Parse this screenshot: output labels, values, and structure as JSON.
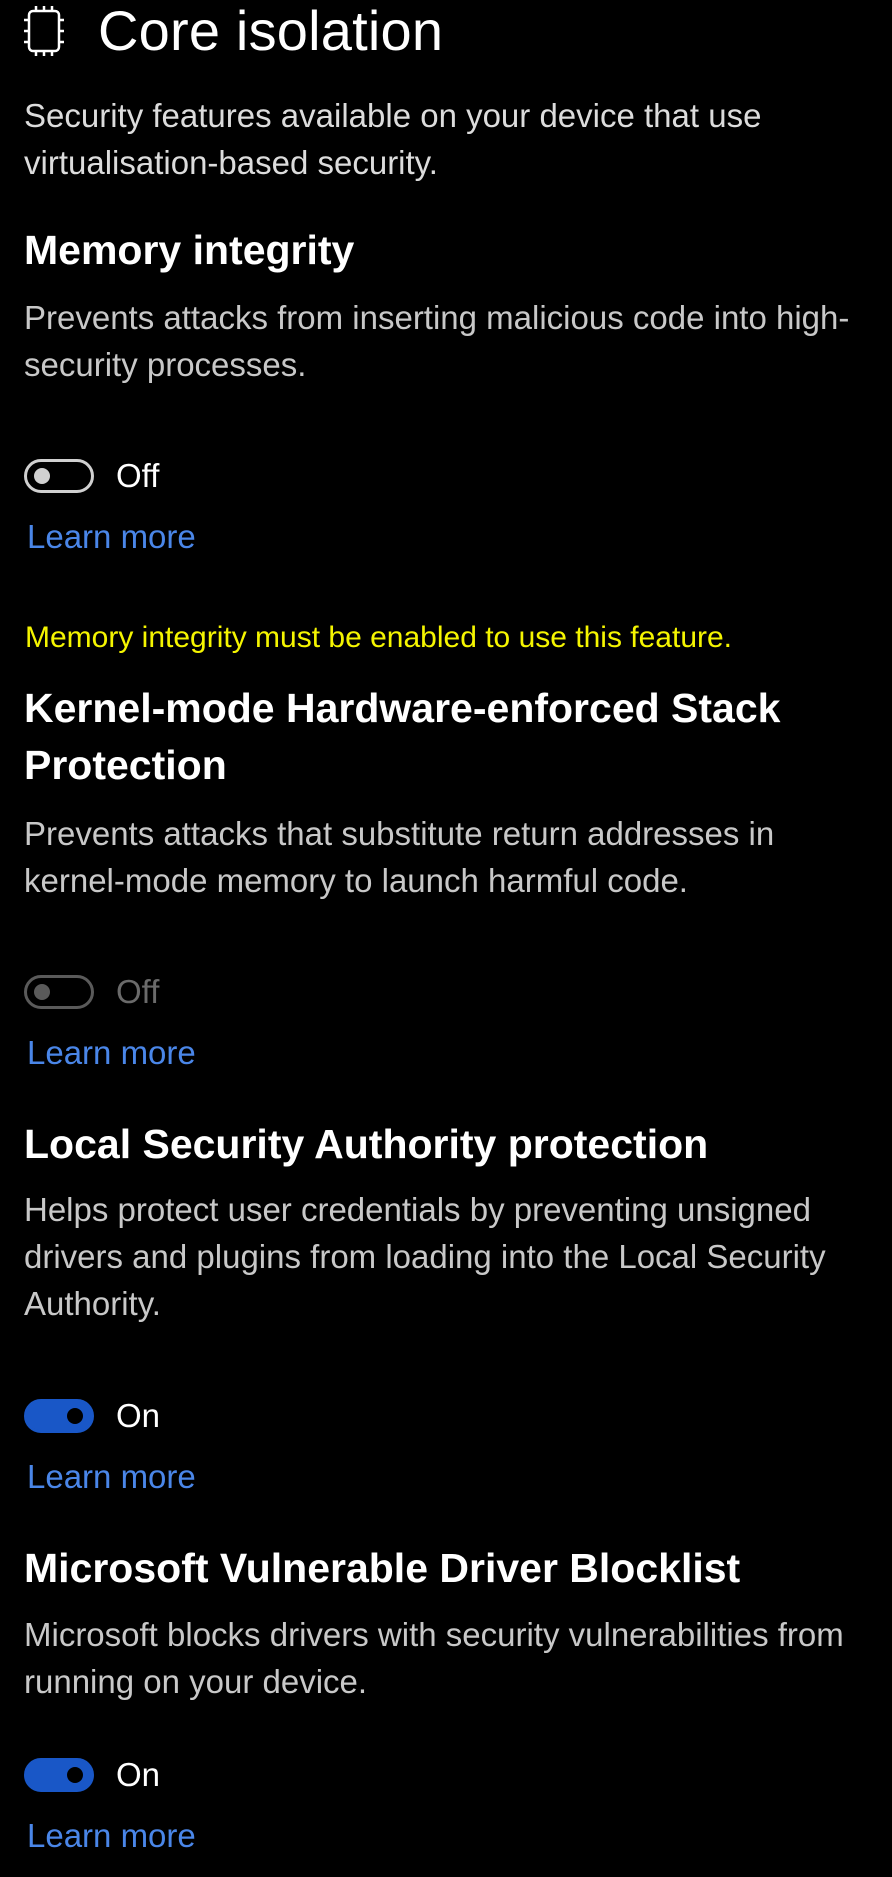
{
  "header": {
    "icon": "core-isolation-chip-icon",
    "title": "Core isolation"
  },
  "intro": "Security features available on your device that use virtualisation-based security.",
  "colors": {
    "background": "#000000",
    "link": "#4a86e8",
    "toggle_on": "#1957c7",
    "warning": "#f5f500"
  },
  "sections": [
    {
      "title": "Memory integrity",
      "description": "Prevents attacks from inserting malicious code into high-security processes.",
      "toggle": {
        "state": "off",
        "label": "Off",
        "enabled": true
      },
      "link": "Learn more"
    },
    {
      "warning": "Memory integrity must be enabled to use this feature.",
      "title": "Kernel-mode Hardware-enforced Stack Protection",
      "description": "Prevents attacks that substitute return addresses in kernel-mode memory to launch harmful code.",
      "toggle": {
        "state": "off",
        "label": "Off",
        "enabled": false
      },
      "link": "Learn more"
    },
    {
      "title": "Local Security Authority protection",
      "description": "Helps protect user credentials by preventing unsigned drivers and plugins from loading into the Local Security Authority.",
      "toggle": {
        "state": "on",
        "label": "On",
        "enabled": true
      },
      "link": "Learn more"
    },
    {
      "title": "Microsoft Vulnerable Driver Blocklist",
      "description": "Microsoft blocks drivers with security vulnerabilities from running on your device.",
      "toggle": {
        "state": "on",
        "label": "On",
        "enabled": true
      },
      "link": "Learn more"
    }
  ]
}
